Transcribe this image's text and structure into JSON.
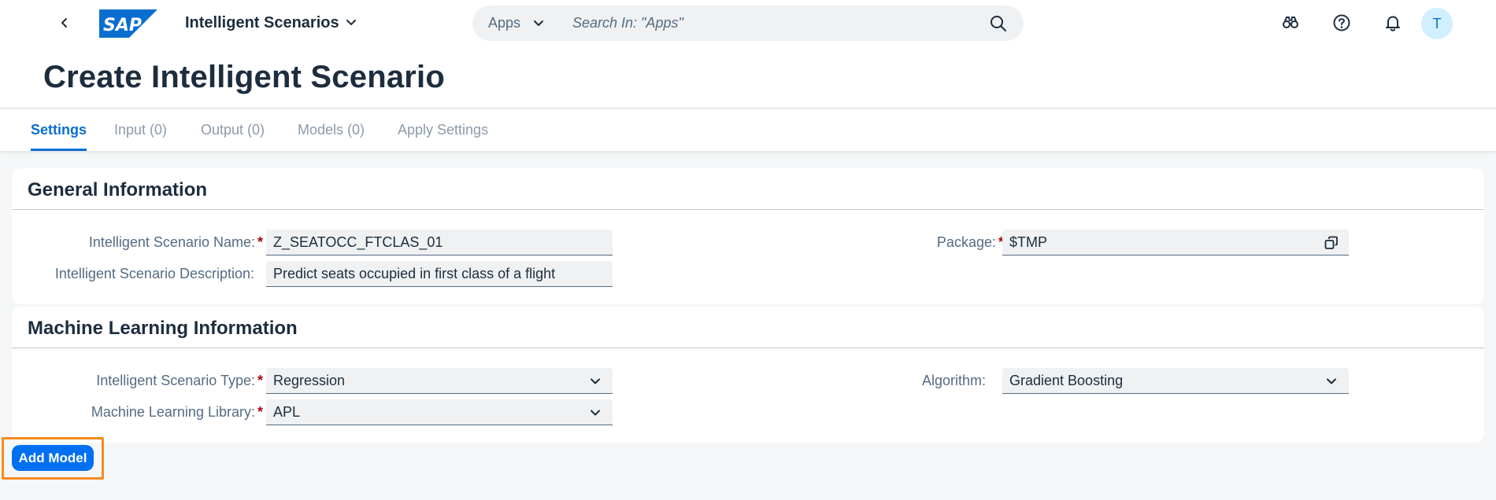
{
  "shell": {
    "app_title": "Intelligent Scenarios",
    "search": {
      "scope": "Apps",
      "placeholder": "Search In: \"Apps\""
    },
    "user_initial": "T",
    "brand_color": "#0a6ed1",
    "icons": [
      "back-icon",
      "sap-logo",
      "chevron-down-icon",
      "search-icon",
      "binoculars-icon",
      "help-icon",
      "bell-icon"
    ]
  },
  "page": {
    "title": "Create Intelligent Scenario"
  },
  "tabs": [
    {
      "label": "Settings",
      "active": true
    },
    {
      "label": "Input (0)",
      "active": false
    },
    {
      "label": "Output (0)",
      "active": false
    },
    {
      "label": "Models (0)",
      "active": false
    },
    {
      "label": "Apply Settings",
      "active": false
    }
  ],
  "general": {
    "title": "General Information",
    "name_label": "Intelligent Scenario Name:",
    "name_value": "Z_SEATOCC_FTCLAS_01",
    "description_label": "Intelligent Scenario Description:",
    "description_value": "Predict seats occupied in first class of a flight",
    "package_label": "Package:",
    "package_value": "$TMP"
  },
  "ml": {
    "title": "Machine Learning Information",
    "type_label": "Intelligent Scenario Type:",
    "type_value": "Regression",
    "library_label": "Machine Learning Library:",
    "library_value": "APL",
    "algorithm_label": "Algorithm:",
    "algorithm_value": "Gradient Boosting"
  },
  "required_marker": "*",
  "actions": {
    "add_model_label": "Add Model"
  }
}
